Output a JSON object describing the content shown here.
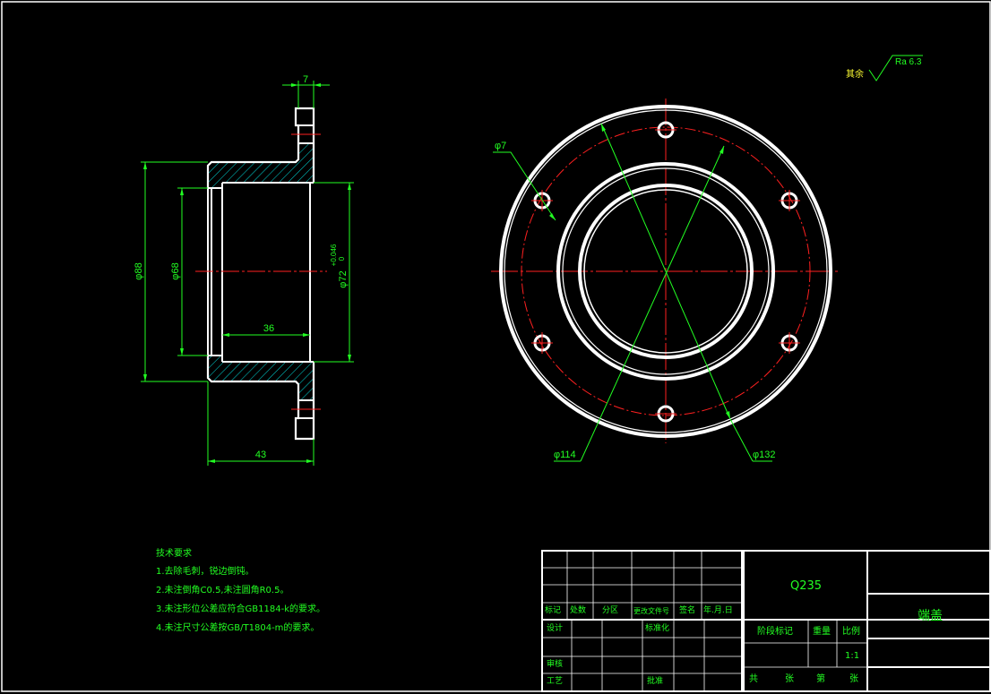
{
  "dimensions": {
    "flange_thickness": "7",
    "outer_diameter": "φ88",
    "inner_diameter": "φ68",
    "fit_diameter": "φ72",
    "fit_tolerance": "+0.046",
    "fit_tolerance_lower": "0",
    "bore_depth": "36",
    "total_length": "43",
    "hole_diameter": "φ7",
    "pcd_diameter": "φ114",
    "flange_diameter": "φ132"
  },
  "roughness": {
    "label": "其余",
    "value": "Ra 6.3"
  },
  "technical_requirements": {
    "title": "技术要求",
    "items": [
      "1.去除毛刺，锐边倒钝。",
      "2.未注倒角C0.5,未注圆角R0.5。",
      "3.未注形位公差应符合GB1184-k的要求。",
      "4.未注尺寸公差按GB/T1804-m的要求。"
    ]
  },
  "title_block": {
    "material": "Q235",
    "part_name": "端盖",
    "header": {
      "mark": "标记",
      "count": "处数",
      "zone": "分区",
      "change_doc": "更改文件号",
      "signature": "签名",
      "date": "年.月.日"
    },
    "design": "设计",
    "standardize": "标准化",
    "review": "审核",
    "process": "工艺",
    "approve": "批准",
    "stage_mark": "阶段标记",
    "weight": "重量",
    "scale": "比例",
    "scale_value": "1:1",
    "total": "共",
    "sheet_unit": "张",
    "sheet_no": "第",
    "sheet_unit2": "张"
  }
}
